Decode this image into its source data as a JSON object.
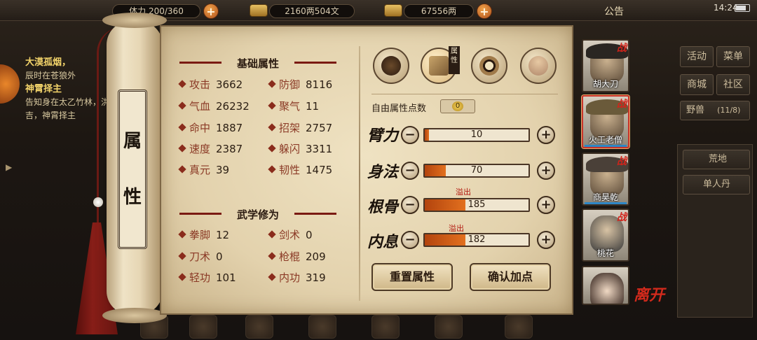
{
  "topbar": {
    "stamina": "体力 200/360",
    "silver": "2160两504文",
    "gold": "67556两",
    "notice": "公告",
    "clock": "14:24"
  },
  "quest": {
    "lines": [
      {
        "title": "大漠孤烟，",
        "text": "辰时在苍狼外"
      },
      {
        "title": "神霄择主",
        "text": "告知身在太乙竹林，洪吉，神霄择主"
      }
    ]
  },
  "scroll_label": [
    "属",
    "性"
  ],
  "basic": {
    "title": "基础属性",
    "stats": [
      {
        "label": "攻击",
        "value": "3662"
      },
      {
        "label": "防御",
        "value": "8116"
      },
      {
        "label": "气血",
        "value": "26232"
      },
      {
        "label": "聚气",
        "value": "11"
      },
      {
        "label": "命中",
        "value": "1887"
      },
      {
        "label": "招架",
        "value": "2757"
      },
      {
        "label": "速度",
        "value": "2387"
      },
      {
        "label": "躲闪",
        "value": "3311"
      },
      {
        "label": "真元",
        "value": "39"
      },
      {
        "label": "韧性",
        "value": "1475"
      }
    ]
  },
  "martial": {
    "title": "武学修为",
    "stats": [
      {
        "label": "拳脚",
        "value": "12"
      },
      {
        "label": "剑术",
        "value": "0"
      },
      {
        "label": "刀术",
        "value": "0"
      },
      {
        "label": "枪棍",
        "value": "209"
      },
      {
        "label": "轻功",
        "value": "101"
      },
      {
        "label": "内功",
        "value": "319"
      }
    ]
  },
  "tabs": {
    "active_tag": "属性",
    "icons": [
      "hat-tab-icon",
      "attribute-scroll-tab-icon",
      "bagua-tab-icon",
      "body-tab-icon"
    ]
  },
  "free_points": {
    "label": "自由属性点数",
    "value": "0"
  },
  "attributes": [
    {
      "name": "臂力",
      "value": "10",
      "fill": 0.04,
      "overflow": ""
    },
    {
      "name": "身法",
      "value": "70",
      "fill": 0.2,
      "overflow": ""
    },
    {
      "name": "根骨",
      "value": "185",
      "fill": 0.39,
      "overflow": "溢出"
    },
    {
      "name": "内息",
      "value": "182",
      "fill": 0.39,
      "overflow": "溢出"
    }
  ],
  "buttons": {
    "reset": "重置属性",
    "confirm": "确认加点"
  },
  "heroes": [
    {
      "name": "胡大刀",
      "tag": "战"
    },
    {
      "name": "火工老僧",
      "tag": "战"
    },
    {
      "name": "商昊乾",
      "tag": "战"
    },
    {
      "name": "桃花",
      "tag": "战"
    },
    {
      "name": "",
      "tag": ""
    }
  ],
  "leave": "离开",
  "right_menu": {
    "row1": [
      "活动",
      "菜单"
    ],
    "row2": [
      "商城",
      "社区"
    ],
    "pet": "野兽",
    "pet_count": "(11/8)",
    "items": [
      "荒地",
      "单人丹"
    ]
  },
  "colors": {
    "accent": "#8b3a26",
    "bar_fill": "#e2701e",
    "overflow": "#b2160e",
    "select": "#c9342a"
  }
}
